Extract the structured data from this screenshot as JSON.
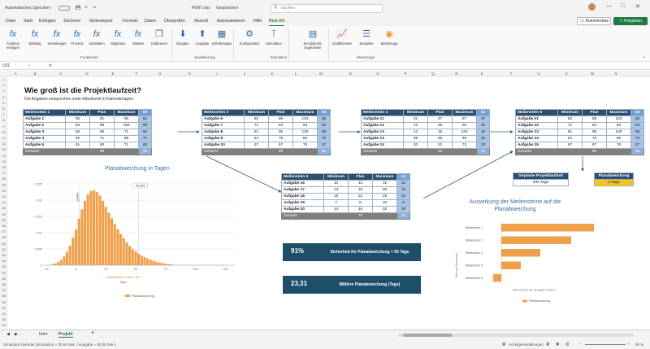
{
  "titlebar": {
    "autosave": "Automatisches Speichern",
    "filename": "PERT.xlsx",
    "saved_state": "Gespeichert",
    "search_placeholder": "Suchen"
  },
  "menu": {
    "items": [
      "Datei",
      "Start",
      "Einfügen",
      "Zeichnen",
      "Seitenlayout",
      "Formeln",
      "Daten",
      "Überprüfen",
      "Ansicht",
      "Automatisieren",
      "Hilfe",
      "Risk Kit"
    ],
    "active": "Risk Kit",
    "comments_label": "Kommentare",
    "share_label": "Freigeben"
  },
  "ribbon": {
    "buttons": [
      {
        "label": "Funktion einfügen",
        "icon": "function-icon"
      },
      {
        "label": "Beliebig",
        "icon": "function-icon"
      },
      {
        "label": "Verteilungen",
        "icon": "function-icon"
      },
      {
        "label": "Prozess",
        "icon": "function-icon"
      },
      {
        "label": "Statistiken",
        "icon": "function-icon"
      },
      {
        "label": "Allgemein",
        "icon": "function-icon"
      },
      {
        "label": "Weitere",
        "icon": "function-icon"
      },
      {
        "label": "Kalibrieren",
        "icon": "calibrate-icon"
      },
      {
        "label": "Eingabe",
        "icon": "input-arrow-icon"
      },
      {
        "label": "Ausgabe",
        "icon": "output-arrow-icon"
      },
      {
        "label": "Zell-Manager",
        "icon": "cell-manager-icon"
      },
      {
        "label": "Konfiguration",
        "icon": "config-icon"
      },
      {
        "label": "Simulation",
        "icon": "simulation-icon"
      },
      {
        "label": "Simulations-Ergebnisse",
        "icon": "results-icon"
      },
      {
        "label": "Grafikfenster",
        "icon": "chart-window-icon"
      },
      {
        "label": "Beispiele",
        "icon": "examples-icon"
      },
      {
        "label": "Werkzeuge",
        "icon": "tools-icon"
      }
    ],
    "groups": [
      "Funktionen",
      "Modellierung",
      "Simulation",
      "Werkzeuge"
    ]
  },
  "formula": {
    "namebox": "U31",
    "fx": "fx",
    "value": ""
  },
  "columns": [
    "A",
    "B",
    "C",
    "D",
    "E",
    "F",
    "G",
    "H",
    "I",
    "J",
    "K",
    "L",
    "M",
    "N",
    "O",
    "P",
    "Q",
    "R",
    "S",
    "T",
    "U",
    "V",
    "W",
    "X"
  ],
  "rows": [
    "1",
    "2",
    "3",
    "4",
    "5",
    "6",
    "7",
    "8",
    "9",
    "10",
    "11",
    "12",
    "13",
    "14",
    "15",
    "16",
    "17",
    "18",
    "19",
    "20",
    "21",
    "22",
    "23",
    "24",
    "25",
    "26",
    "27",
    "28",
    "29",
    "30",
    "31",
    "32",
    "33",
    "34",
    "35",
    "36",
    "37",
    "38",
    "39",
    "40",
    "41",
    "42",
    "43"
  ],
  "sheet": {
    "title": "Wie groß ist die Projektlaufzeit?",
    "subtitle": "Die Angaben entsprechen einer Arbeitszeit in Kalendertagen.",
    "headers": [
      "Minimum",
      "Plan",
      "Maximum",
      "Ist"
    ],
    "total_label": "Gesamt",
    "milestones": [
      {
        "name": "Meilenstein 1",
        "rows": [
          [
            "Aufgabe 1",
            "69",
            "81",
            "86",
            "81"
          ],
          [
            "Aufgabe 2",
            "83",
            "98",
            "165",
            "98"
          ],
          [
            "Aufgabe 3",
            "56",
            "66",
            "71",
            "66"
          ],
          [
            "Aufgabe 4",
            "60",
            "71",
            "99",
            "71"
          ],
          [
            "Aufgabe 5",
            "51",
            "60",
            "71",
            "60"
          ]
        ],
        "plan_total": "98",
        "ist_total": "98"
      },
      {
        "name": "Meilenstein 2",
        "rows": [
          [
            "Aufgabe 6",
            "82",
            "96",
            "103",
            "96"
          ],
          [
            "Aufgabe 7",
            "71",
            "83",
            "93",
            "83"
          ],
          [
            "Aufgabe 8",
            "81",
            "95",
            "135",
            "95"
          ],
          [
            "Aufgabe 9",
            "64",
            "75",
            "80",
            "75"
          ],
          [
            "Aufgabe 10",
            "57",
            "67",
            "76",
            "67"
          ]
        ],
        "plan_total": "96",
        "ist_total": "96"
      },
      {
        "name": "Meilenstein 3",
        "rows": [
          [
            "Aufgabe 11",
            "31",
            "37",
            "87",
            "37"
          ],
          [
            "Aufgabe 12",
            "21",
            "25",
            "50",
            "25"
          ],
          [
            "Aufgabe 13",
            "14",
            "16",
            "125",
            "16"
          ],
          [
            "Aufgabe 14",
            "38",
            "45",
            "69",
            "45"
          ],
          [
            "Aufgabe 15",
            "20",
            "23",
            "72",
            "23"
          ]
        ],
        "plan_total": "45",
        "ist_total": "45"
      },
      {
        "name": "Meilenstein 4",
        "rows": [
          [
            "Aufgabe 16",
            "10",
            "12",
            "15",
            "12"
          ],
          [
            "Aufgabe 17",
            "13",
            "15",
            "28",
            "15"
          ],
          [
            "Aufgabe 18",
            "19",
            "22",
            "28",
            "22"
          ],
          [
            "Aufgabe 19",
            "7",
            "8",
            "15",
            "8"
          ],
          [
            "Aufgabe 20",
            "14",
            "16",
            "32",
            "16"
          ]
        ],
        "plan_total": "22",
        "ist_total": "22"
      },
      {
        "name": "Meilenstein 5",
        "rows": [
          [
            "Aufgabe 21",
            "82",
            "96",
            "103",
            "96"
          ],
          [
            "Aufgabe 22",
            "71",
            "83",
            "93",
            "83"
          ],
          [
            "Aufgabe 23",
            "81",
            "95",
            "105",
            "95"
          ],
          [
            "Aufgabe 24",
            "64",
            "75",
            "80",
            "75"
          ],
          [
            "Aufgabe 25",
            "57",
            "67",
            "76",
            "67"
          ]
        ],
        "plan_total": "95",
        "ist_total": "95"
      }
    ],
    "planned_label": "Geplante Projektlaufzeit",
    "planned_value": "335 Tage",
    "deviation_label": "Planabweichung",
    "deviation_value": "0 Tage",
    "kpi1_value": "91%",
    "kpi1_label": "Sicherheit für Planabweichung < 50 Tage",
    "kpi2_value": "23,31",
    "kpi2_label": "Mittlere Planabweichung (Tage)"
  },
  "chart_data": [
    {
      "type": "bar",
      "title": "Planabweichung in Tagen",
      "xlabel": "Tage",
      "ylabel": "",
      "x_ticks": [
        "-25",
        "0",
        "25",
        "50",
        "75",
        "100",
        "125"
      ],
      "y_ticks": [
        "0",
        "0,005",
        "0,01",
        "0,015",
        "0,02",
        "0,025"
      ],
      "xlim": [
        -27,
        133
      ],
      "ylim": [
        0,
        0.025
      ],
      "legend": "Planabweichung",
      "annotation_top": "90,00%",
      "annotation_left": "10,00%",
      "footer": "Spannweite 5,00% = 80",
      "bin_width": 2.5,
      "x": [
        -20,
        -17.5,
        -15,
        -12.5,
        -10,
        -7.5,
        -5,
        -2.5,
        0,
        2.5,
        5,
        7.5,
        10,
        12.5,
        15,
        17.5,
        20,
        22.5,
        25,
        27.5,
        30,
        32.5,
        35,
        37.5,
        40,
        42.5,
        45,
        47.5,
        50,
        52.5,
        55,
        57.5,
        60,
        62.5,
        65,
        67.5,
        70,
        72.5,
        75,
        77.5,
        80,
        85,
        90,
        95,
        100
      ],
      "values": [
        0.0003,
        0.0006,
        0.001,
        0.0017,
        0.0027,
        0.0042,
        0.006,
        0.0085,
        0.011,
        0.0143,
        0.0172,
        0.0198,
        0.0218,
        0.0228,
        0.0231,
        0.0226,
        0.0214,
        0.0198,
        0.018,
        0.0162,
        0.0144,
        0.0127,
        0.0111,
        0.0096,
        0.0083,
        0.0071,
        0.006,
        0.0051,
        0.0043,
        0.0036,
        0.003,
        0.0025,
        0.0021,
        0.0017,
        0.0014,
        0.0011,
        0.0009,
        0.0007,
        0.0005,
        0.0004,
        0.0003,
        0.0002,
        0.00015,
        0.0001,
        5e-05
      ],
      "color": "#f0a04b"
    },
    {
      "type": "bar",
      "orientation": "horizontal",
      "title": "Auswirkung der Meilensteine auf die Planabweichung",
      "categories": [
        "Meilenstein 1",
        "Meilenstein 2",
        "Meilenstein 3",
        "Meilenstein 4",
        "Meilenstein 5"
      ],
      "values": [
        0.57,
        0.43,
        0.24,
        0.12,
        -0.05
      ],
      "xlabel": "Wirkung auf die Ausgabe (Index)",
      "ylabel": "Wirkung (Spearman)",
      "legend": "Planabweichung",
      "color": "#f0a04b"
    }
  ],
  "tabs": [
    "Intro",
    "Projekt"
  ],
  "active_tab": "Projekt",
  "status": {
    "left": "Simulation beendet (Simulation = 30,64 Sek. / Ausgabe = 00,00 Sek.)",
    "display_settings": "Anzeigeeinstellungen",
    "zoom": "90 %"
  },
  "colors": {
    "header": "#2d4e6e",
    "ist": "#a9c4e6",
    "kpi": "#1f4e69",
    "accent": "#217346",
    "bar": "#f0a04b",
    "highlight": "#f5c518"
  }
}
